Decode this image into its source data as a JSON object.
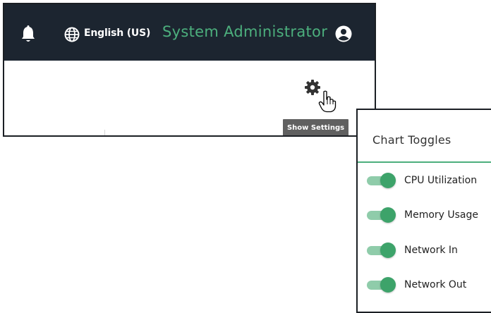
{
  "header": {
    "language": "English (US)",
    "user_name": "System Administrator"
  },
  "icons": {
    "notifications": "bell-icon",
    "language": "globe-icon",
    "user": "user-circle-icon",
    "settings": "gear-icon",
    "cursor": "hand-pointer-icon"
  },
  "tooltip": {
    "text": "Show Settings"
  },
  "panel": {
    "title": "Chart Toggles",
    "toggles": [
      {
        "label": "CPU Utilization",
        "on": true
      },
      {
        "label": "Memory Usage",
        "on": true
      },
      {
        "label": "Network In",
        "on": true
      },
      {
        "label": "Network Out",
        "on": true
      }
    ]
  },
  "colors": {
    "topbar_bg": "#1c2530",
    "accent_green": "#4caf7d",
    "toggle_track": "#8fccaa",
    "toggle_knob": "#3da36a",
    "tooltip_bg": "#606060"
  }
}
